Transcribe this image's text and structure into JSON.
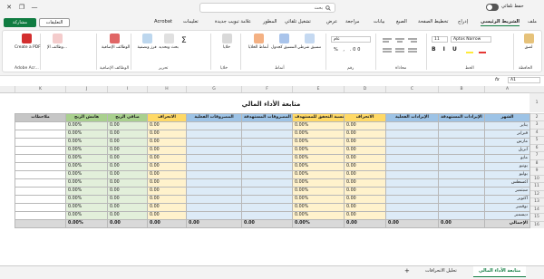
{
  "titlebar": {
    "autosave": "حفظ تلقائي",
    "search_placeholder": "بحث",
    "minimize": "—",
    "restore": "❐",
    "close": "✕"
  },
  "tabs": [
    "ملف",
    "الشريط الرئيسي",
    "إدراج",
    "تخطيط الصفحة",
    "الصيغ",
    "بيانات",
    "مراجعة",
    "عرض",
    "تشغيل تلقائي",
    "المطور",
    "علامة تبويب جديدة",
    "تعليمات",
    "Acrobat"
  ],
  "share_label": "مشاركة",
  "comments_label": "التعليقات",
  "ribbon": {
    "clipboard": "الحافظة",
    "paste": "لصق",
    "font": "الخط",
    "font_name": "Aptos Narrow",
    "font_size": "11",
    "alignment": "محاذاة",
    "number": "رقم",
    "number_format": "عام",
    "styles": "أنماط",
    "cond_format": "تنسيق شرطي",
    "format_table": "التنسيق كجدول",
    "cell_styles": "أنماط الخلايا",
    "cells": "خلايا",
    "cells_btn": "خلايا",
    "editing": "تحرير",
    "sort": "فرز وتصفية",
    "find": "بحث وتحديد",
    "addins": "الوظائف الإضافية",
    "addins_btn": "الوظائف الإضافية",
    "analysis": "وظائف الإ...",
    "adobe": "Adobe Acr...",
    "create_pdf": "Create a PDF"
  },
  "namebox": "A1",
  "fx": "fx",
  "columns": [
    "A",
    "B",
    "C",
    "D",
    "E",
    "F",
    "G",
    "H",
    "I",
    "J",
    "K"
  ],
  "sheet_title": "متابعة الأداء المالي",
  "headers": [
    "الشهر",
    "الإيرادات المستهدفة",
    "الإيرادات الفعلية",
    "الانحراف",
    "نسبة التحقق للمستهدف",
    "المصروفات المستهدفة",
    "المصروفات الفعلية",
    "الانحراف",
    "صافي الربح",
    "هامش الربح",
    "ملاحظات"
  ],
  "months": [
    "يناير",
    "فبراير",
    "مارس",
    "أبريل",
    "مايو",
    "يونيو",
    "يوليو",
    "أغسطس",
    "سبتمبر",
    "أكتوبر",
    "نوفمبر",
    "ديسمبر"
  ],
  "zero": "0.00",
  "pct": "0.00%",
  "total_label": "الإجمالي",
  "sheet_tabs": [
    "متابعة الأداء المالي",
    "تحليل الانحرافات"
  ],
  "add_sheet": "+"
}
